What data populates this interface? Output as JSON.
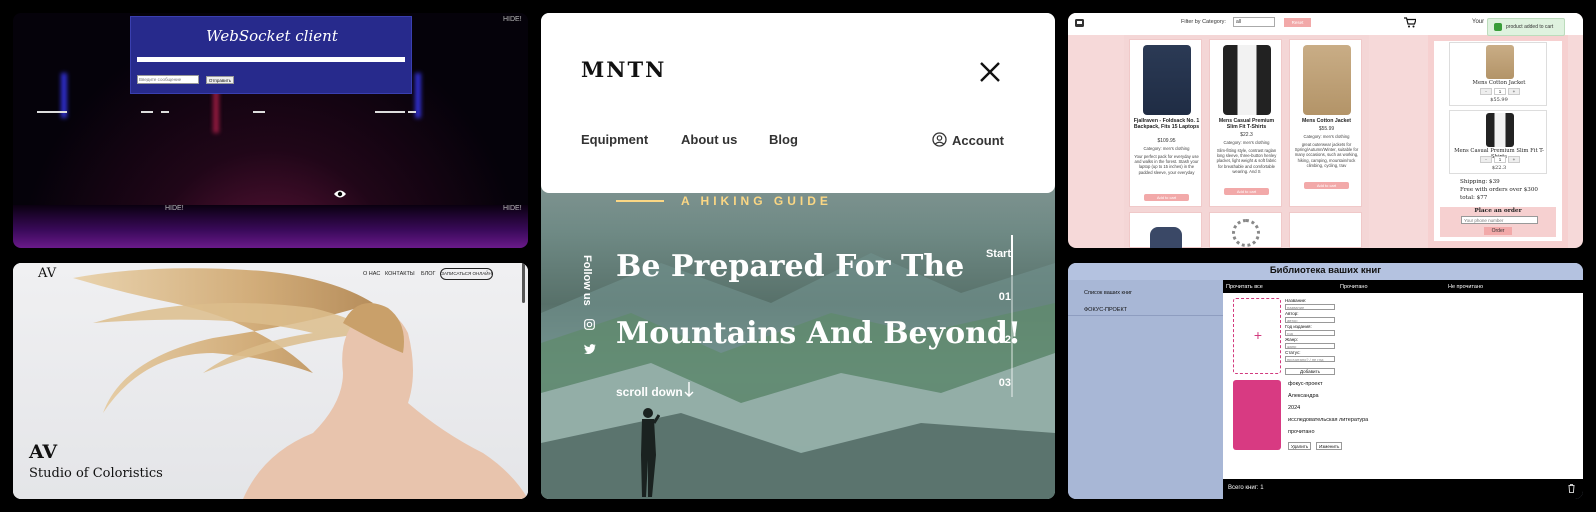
{
  "websocket": {
    "title": "WebSocket client",
    "input_placeholder": "Введите сообщение",
    "send_label": "Отправить",
    "hide_label": "HIDE!"
  },
  "mntn": {
    "logo": "MNTN",
    "nav": [
      "Equipment",
      "About us",
      "Blog"
    ],
    "account": "Account",
    "eyebrow": "A HIKING GUIDE",
    "headline_1": "Be Prepared For The",
    "headline_2": "Mountains And Beyond!",
    "follow": "Follow us",
    "scroll": "scroll down",
    "steps": [
      "Start",
      "01",
      "02",
      "03"
    ],
    "accent": "#fbd784"
  },
  "shop": {
    "filter_label": "Filter by Category:",
    "filter_value": "all",
    "reset_label": "Reset",
    "your_label": "Your",
    "toast": "product added to cart",
    "products": [
      {
        "name": "Fjallraven - Foldsack No. 1 Backpack, Fits 15 Laptops",
        "price": "$109.95",
        "category": "Category: men's clothing",
        "desc": "Your perfect pack for everyday use and walks in the forest. Stash your laptop (up to 15 inches) in the padded sleeve, your everyday",
        "add": "Add to cart"
      },
      {
        "name": "Mens Casual Premium Slim Fit T-Shirts",
        "price": "$22.3",
        "category": "Category: men's clothing",
        "desc": "Slim-fitting style, contrast raglan long sleeve, three-button henley placket, light weight & soft fabric for breathable and comfortable wearing. And S",
        "add": "Add to cart"
      },
      {
        "name": "Mens Cotton Jacket",
        "price": "$55.99",
        "category": "Category: men's clothing",
        "desc": "great outerwear jackets for Spring/Autumn/Winter, suitable for many occasions, such as working, hiking, camping, mountain/rock climbing, cycling, trav",
        "add": "Add to cart"
      }
    ],
    "cart_items": [
      {
        "name": "Mens Cotton Jacket",
        "qty": "1",
        "price": "$55.99"
      },
      {
        "name": "Mens Casual Premium Slim Fit T-Shirts",
        "qty": "1",
        "price": "$22.3"
      }
    ],
    "shipping": "Shipping: $39",
    "free_note": "Free with orders over $300",
    "total": "total: $77",
    "place_order": "Place an order",
    "phone_placeholder": "Your phone number",
    "order_label": "Order"
  },
  "studio": {
    "logo": "AV",
    "nav": [
      "О НАС",
      "КОНТАКТЫ",
      "БЛОГ"
    ],
    "cta": "ЗАПИСАТЬСЯ ОНЛАЙН",
    "title": "AV",
    "subtitle": "Studio of Coloristics"
  },
  "library": {
    "title": "Библиотека ваших книг",
    "sidebar": [
      "Список ваших книг",
      "ФОКУС-ПРОЕКТ"
    ],
    "tabs": [
      "Прочитать все",
      "Прочитано",
      "Не прочитано"
    ],
    "form": {
      "title_label": "Название:",
      "title_value": "название",
      "author_label": "Автор:",
      "author_value": "автор",
      "year_label": "Год издания:",
      "year_value": "год",
      "genre_label": "Жанр:",
      "genre_value": "жанр",
      "status_label": "Статус:",
      "status_value": "прочитано? / не глд",
      "add_label": "Добавить"
    },
    "book": {
      "title": "фокус-проект",
      "author": "Александра",
      "year": "2024",
      "genre": "исследовательская литература",
      "status": "прочитано",
      "delete": "Удалить",
      "edit": "Изменить"
    },
    "count": "Всего книг: 1"
  }
}
